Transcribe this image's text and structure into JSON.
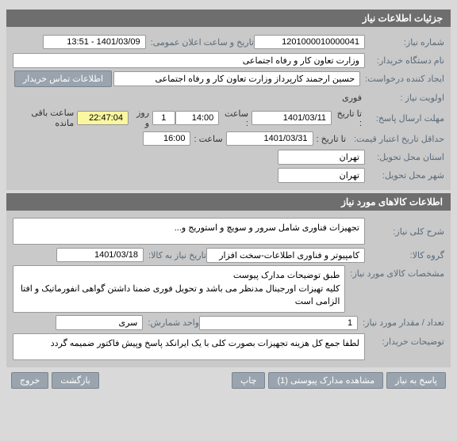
{
  "header1": "جزئیات اطلاعات نیاز",
  "need": {
    "number_label": "شماره نیاز:",
    "number": "1201000010000041",
    "announce_label": "تاریخ و ساعت اعلان عمومی:",
    "announce_value": "1401/03/09 - 13:51",
    "buyer_label": "نام دستگاه خریدار:",
    "buyer": "وزارت تعاون کار و رفاه اجتماعی",
    "requester_label": "ایجاد کننده درخواست:",
    "requester": "حسین ارجمند کارپرداز وزارت تعاون کار و رفاه اجتماعی",
    "contact_btn": "اطلاعات تماس خریدار",
    "priority_label": "اولویت نیاز :",
    "priority": "فوری",
    "reply_deadline_label": "مهلت ارسال پاسخ:",
    "to_date_label": "تا تاریخ :",
    "reply_date": "1401/03/11",
    "time_label": "ساعت :",
    "reply_time": "14:00",
    "days_value": "1",
    "days_label": "روز و",
    "countdown": "22:47:04",
    "countdown_label": "ساعت باقی مانده",
    "price_valid_label": "حداقل تاریخ اعتبار قیمت:",
    "price_valid_date": "1401/03/31",
    "price_valid_time": "16:00",
    "delivery_province_label": "استان محل تحویل:",
    "delivery_province": "تهران",
    "delivery_city_label": "شهر محل تحویل:",
    "delivery_city": "تهران"
  },
  "header2": "اطلاعات کالاهای مورد نیاز",
  "goods": {
    "desc_label": "شرح کلی نیاز:",
    "desc": "تجهیزات  فناوری شامل سرور  و سویچ و استوریج و...",
    "group_label": "گروه کالا:",
    "group": "کامپیوتر و فناوری اطلاعات-سخت افزار",
    "need_date_label": "تاریخ نیاز به کالا:",
    "need_date": "1401/03/18",
    "specs_label": "مشخصات کالای مورد نیاز:",
    "specs": "طبق توضیحات مدارک پیوست\nکلیه تهیزات اورجینال مدنظر می باشد و تحویل فوری   ضمنا داشتن گواهی انفورماتیک و افتا الزامی است",
    "qty_label": "تعداد / مقدار مورد نیاز:",
    "qty": "1",
    "unit_label": "واحد شمارش:",
    "unit": "سری",
    "buyer_notes_label": "توضیحات خریدار:",
    "buyer_notes": "لطفا جمع کل هزینه تجهیزات بصورت کلی با یک ایرانکد پاسخ وپیش فاکتور ضمیمه گردد"
  },
  "footer": {
    "reply_btn": "پاسخ به نیاز",
    "attach_btn": "مشاهده مدارک پیوستی (1)",
    "print_btn": "چاپ",
    "back_btn": "بازگشت",
    "exit_btn": "خروج"
  }
}
